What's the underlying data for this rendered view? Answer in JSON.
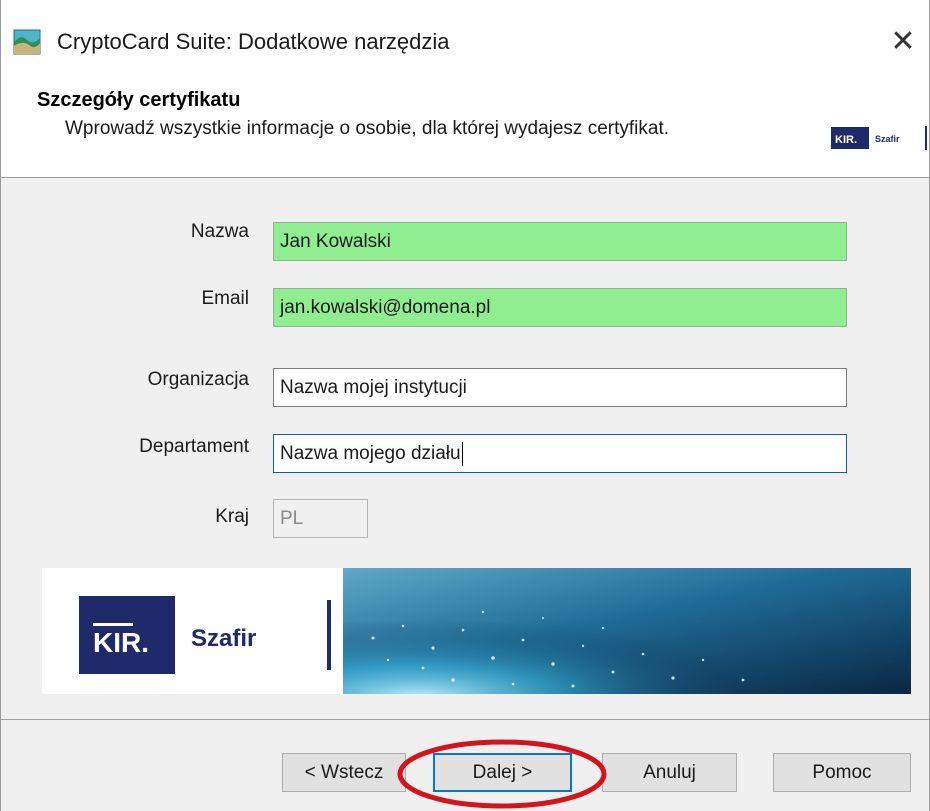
{
  "window": {
    "title": "CryptoCard Suite: Dodatkowe narzędzia",
    "close_glyph": "✕",
    "icon": "app-icon"
  },
  "header": {
    "title": "Szczegóły certyfikatu",
    "subtitle": "Wprowadź wszystkie informacje o osobie, dla której wydajesz certyfikat.",
    "logo_text_kir": "KIR.",
    "logo_text_brand": "Szafir"
  },
  "form": {
    "nazwa": {
      "label": "Nazwa",
      "value": "Jan Kowalski"
    },
    "email": {
      "label": "Email",
      "value": "jan.kowalski@domena.pl"
    },
    "organizacja": {
      "label": "Organizacja",
      "value": "Nazwa mojej instytucji"
    },
    "departament": {
      "label": "Departament",
      "value": "Nazwa mojego działu"
    },
    "kraj": {
      "label": "Kraj",
      "value": "PL"
    }
  },
  "banner": {
    "logo_kir": "KIR.",
    "logo_brand": "Szafir"
  },
  "buttons": {
    "back": "< Wstecz",
    "next": "Dalej >",
    "cancel": "Anuluj",
    "help": "Pomoc"
  },
  "colors": {
    "valid_field": "#90ee90",
    "kir_navy": "#1f2a6b",
    "annotation_red": "#d4141b",
    "focus_blue": "#0078d7"
  }
}
